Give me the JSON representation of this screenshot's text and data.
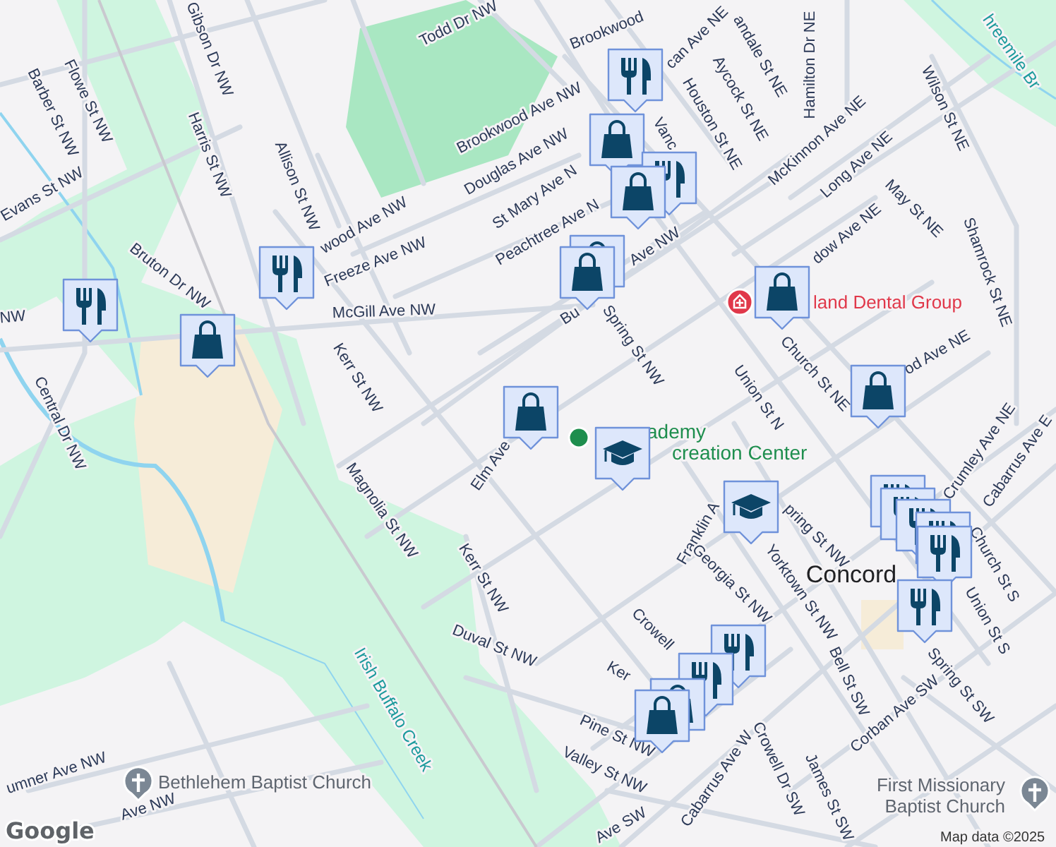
{
  "map": {
    "labels": [
      {
        "text": "Todd Dr NW",
        "kind": "street"
      },
      {
        "text": "Brookwood",
        "kind": "street"
      },
      {
        "text": "Brookwood Ave NW",
        "kind": "street"
      },
      {
        "text": "Douglas Ave NW",
        "kind": "street"
      },
      {
        "text": "St Mary Ave N",
        "kind": "street"
      },
      {
        "text": "Peachtree Ave N",
        "kind": "street"
      },
      {
        "text": "Gibson Dr NW",
        "kind": "street"
      },
      {
        "text": "Harris St NW",
        "kind": "street"
      },
      {
        "text": "Allison St NW",
        "kind": "street"
      },
      {
        "text": "Flowe St NW",
        "kind": "street"
      },
      {
        "text": "Barber St NW",
        "kind": "street"
      },
      {
        "text": "Evans St NW",
        "kind": "street"
      },
      {
        "text": "Bruton Dr NW",
        "kind": "street"
      },
      {
        "text": "wood Ave NW",
        "kind": "street"
      },
      {
        "text": "Freeze Ave NW",
        "kind": "street"
      },
      {
        "text": "McGill Ave NW",
        "kind": "street"
      },
      {
        "text": "NW",
        "kind": "street"
      },
      {
        "text": "Central Dr NW",
        "kind": "street"
      },
      {
        "text": "Kerr St NW",
        "kind": "street"
      },
      {
        "text": "Magnolia St NW",
        "kind": "street"
      },
      {
        "text": "Kerr St NW",
        "kind": "street"
      },
      {
        "text": "Elm Ave",
        "kind": "street"
      },
      {
        "text": "Duval St NW",
        "kind": "street"
      },
      {
        "text": "Spring St NW",
        "kind": "street"
      },
      {
        "text": "Bu",
        "kind": "street"
      },
      {
        "text": "Ave NW",
        "kind": "street"
      },
      {
        "text": "Union St N",
        "kind": "street"
      },
      {
        "text": "Church St NE",
        "kind": "street"
      },
      {
        "text": "Aycock St NE",
        "kind": "street"
      },
      {
        "text": "Houston St NE",
        "kind": "street"
      },
      {
        "text": "Hamilton Dr NE",
        "kind": "street"
      },
      {
        "text": "McKinnon Ave NE",
        "kind": "street"
      },
      {
        "text": "Long Ave NE",
        "kind": "street"
      },
      {
        "text": "May St NE",
        "kind": "street"
      },
      {
        "text": "Wilson St NE",
        "kind": "street"
      },
      {
        "text": "Shamrock St NE",
        "kind": "street"
      },
      {
        "text": "dow Ave NE",
        "kind": "street"
      },
      {
        "text": "od Ave NE",
        "kind": "street"
      },
      {
        "text": "Vanc",
        "kind": "street"
      },
      {
        "text": "can Ave NE",
        "kind": "street"
      },
      {
        "text": "andale St NE",
        "kind": "street"
      },
      {
        "text": "Franklin A",
        "kind": "street"
      },
      {
        "text": "pring St NW",
        "kind": "street"
      },
      {
        "text": "Yorktown St NW",
        "kind": "street"
      },
      {
        "text": "Georgia St NW",
        "kind": "street"
      },
      {
        "text": "Crowell",
        "kind": "street"
      },
      {
        "text": "Ker",
        "kind": "street"
      },
      {
        "text": "Pine St NW",
        "kind": "street"
      },
      {
        "text": "Valley St NW",
        "kind": "street"
      },
      {
        "text": "Cabarrus Ave W",
        "kind": "street"
      },
      {
        "text": "Crowell Dr SW",
        "kind": "street"
      },
      {
        "text": "James St SW",
        "kind": "street"
      },
      {
        "text": "Bell St SW",
        "kind": "street"
      },
      {
        "text": "Corban Ave SW",
        "kind": "street"
      },
      {
        "text": "Spring St SW",
        "kind": "street"
      },
      {
        "text": "Concord",
        "kind": "city"
      },
      {
        "text": "Union St S",
        "kind": "street"
      },
      {
        "text": "Church St S",
        "kind": "street"
      },
      {
        "text": "Crumley Ave NE",
        "kind": "street"
      },
      {
        "text": "Cabarrus Ave E",
        "kind": "street"
      },
      {
        "text": "umner Ave NW",
        "kind": "street"
      },
      {
        "text": "Ave NW",
        "kind": "street"
      },
      {
        "text": "Ave SW",
        "kind": "street"
      },
      {
        "text": "Irish Buffalo Creek",
        "kind": "water"
      },
      {
        "text": "hreemile Br",
        "kind": "water"
      },
      {
        "text": "ademy",
        "kind": "park"
      },
      {
        "text": "creation Center",
        "kind": "park"
      },
      {
        "text": "land Dental Group",
        "kind": "health"
      },
      {
        "text": "Bethlehem Baptist Church",
        "kind": "poi"
      },
      {
        "text": "First Missionary",
        "kind": "poi"
      },
      {
        "text": "Baptist Church",
        "kind": "poi"
      }
    ],
    "pins": [
      {
        "kind": "health"
      },
      {
        "kind": "park"
      },
      {
        "kind": "church"
      },
      {
        "kind": "church"
      }
    ],
    "markers": [
      {
        "kind": "restaurant"
      },
      {
        "kind": "shopping"
      },
      {
        "kind": "restaurant"
      },
      {
        "kind": "restaurant"
      },
      {
        "kind": "shopping"
      },
      {
        "kind": "restaurant"
      },
      {
        "kind": "shopping"
      },
      {
        "kind": "shopping"
      },
      {
        "kind": "shopping"
      },
      {
        "kind": "shopping"
      },
      {
        "kind": "shopping"
      },
      {
        "kind": "shopping"
      },
      {
        "kind": "school"
      },
      {
        "kind": "school"
      },
      {
        "kind": "restaurant"
      },
      {
        "kind": "restaurant"
      },
      {
        "kind": "restaurant"
      },
      {
        "kind": "restaurant"
      },
      {
        "kind": "restaurant"
      },
      {
        "kind": "restaurant"
      },
      {
        "kind": "restaurant"
      },
      {
        "kind": "restaurant"
      },
      {
        "kind": "shopping"
      },
      {
        "kind": "shopping"
      }
    ]
  },
  "attribution": {
    "logo": "Google",
    "text": "Map data ©2025"
  }
}
